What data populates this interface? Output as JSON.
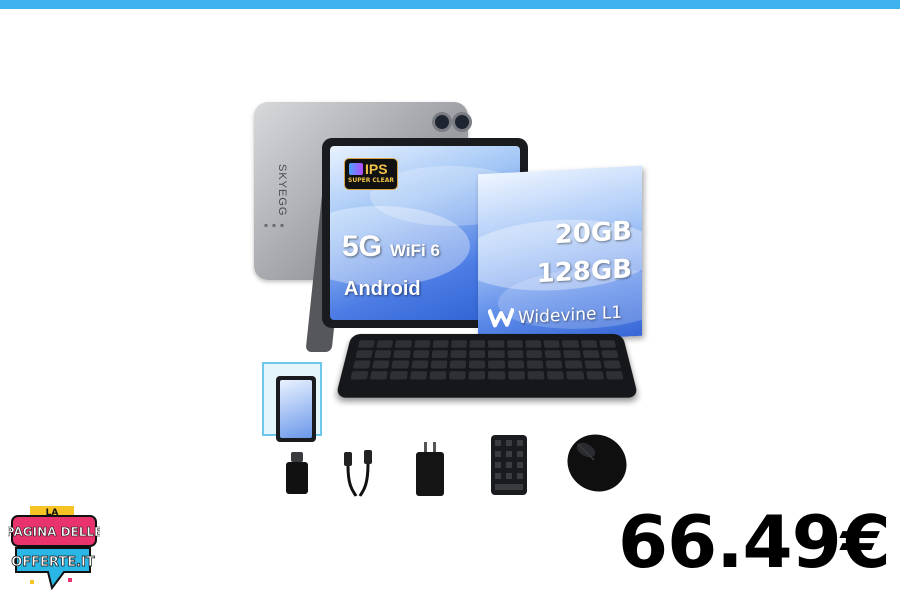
{
  "product": {
    "brand": "SKYEGG",
    "ips_badge": "IPS",
    "ips_sub": "SUPER CLEAR",
    "network": "5G",
    "wifi": "WiFi 6",
    "os": "Android",
    "ram": "20GB",
    "storage": "128GB",
    "drm": "Widevine L1",
    "accessories": [
      "usb-c-adapter-icon",
      "charging-cable-icon",
      "wall-charger-icon",
      "mini-keyboard-icon",
      "wireless-mouse-icon"
    ]
  },
  "price": "66.49€",
  "logo": {
    "top": "LA",
    "line1": "PAGINA DELLE",
    "line2": "OFFERTE.IT"
  },
  "colors": {
    "top_bar": "#3fb3f0",
    "logo_pink": "#e8336d",
    "logo_cyan": "#2bb7e6",
    "logo_yellow": "#f7c325"
  }
}
